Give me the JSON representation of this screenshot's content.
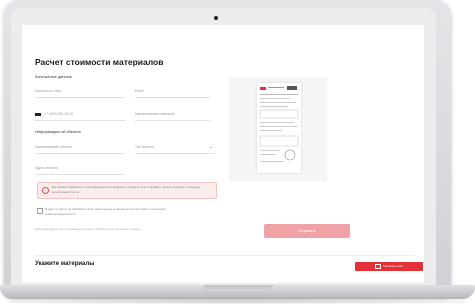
{
  "form": {
    "title": "Расчет стоимости материалов",
    "contact_section": "Контактные данные",
    "fields": {
      "name": "Контактное лицо",
      "email": "Email",
      "phone": "+7 (000) 000-00-00",
      "company": "Наименование компании",
      "object_name": "Наименование объекта",
      "object_type": "Тип объекта",
      "address": "Адрес объекта"
    },
    "object_section": "Информация об объекте",
    "alert_text": "Вы можете прикрепить спецификацию или ведомость объекта, или отправить проект на расчет по адресу электронной почты",
    "consent_text": "Я даю согласие на обработку моих персональных данных в соответствии с политикой конфиденциальности",
    "note_text": "Заполняя форму, вы принимаете условия обработки персональных данных",
    "submit_label": "Отправить"
  },
  "materials_section": {
    "title": "Укажите материалы"
  },
  "sticky_button": {
    "label": "Написать нам"
  },
  "colors": {
    "accent": "#e53238",
    "accent_muted": "#f0a3a6"
  }
}
